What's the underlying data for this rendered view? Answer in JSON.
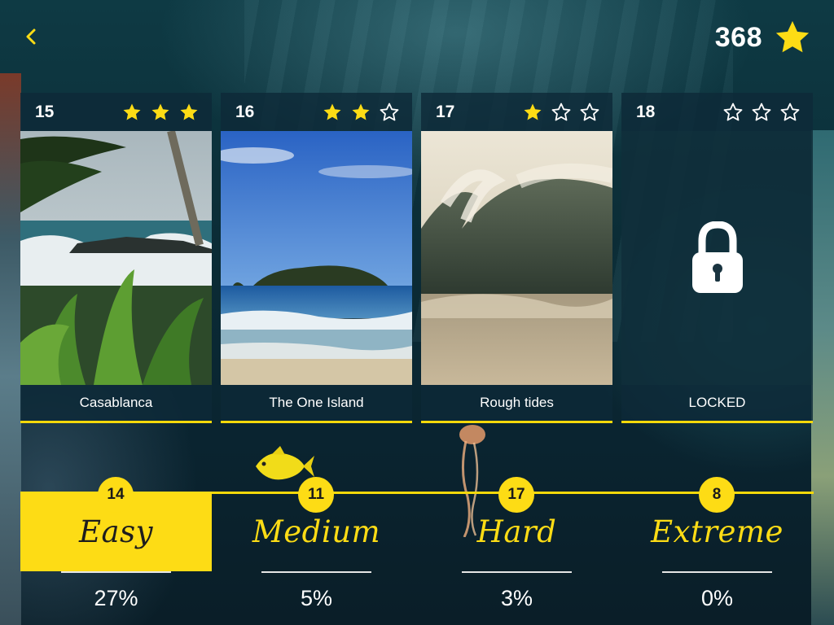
{
  "header": {
    "back_icon": "chevron-left-icon",
    "score": "368",
    "score_icon": "star-icon"
  },
  "colors": {
    "accent": "#fddc15",
    "card_bg": "#0e2a38",
    "star_filled": "#fddc15",
    "star_empty": "#ffffff"
  },
  "levels": [
    {
      "number": "15",
      "stars": 3,
      "title": "Casablanca",
      "image": "tropical-beach-palms",
      "locked": false
    },
    {
      "number": "16",
      "stars": 2,
      "title": "The One Island",
      "image": "island-blue-sky",
      "locked": false
    },
    {
      "number": "17",
      "stars": 1,
      "title": "Rough tides",
      "image": "breaking-wave",
      "locked": false
    },
    {
      "number": "18",
      "stars": 0,
      "title": "LOCKED",
      "image": "lock-icon",
      "locked": true
    }
  ],
  "difficulties": [
    {
      "count": "14",
      "name": "Easy",
      "percent": "27%",
      "active": true
    },
    {
      "count": "11",
      "name": "Medium",
      "percent": "5%",
      "active": false
    },
    {
      "count": "17",
      "name": "Hard",
      "percent": "3%",
      "active": false
    },
    {
      "count": "8",
      "name": "Extreme",
      "percent": "0%",
      "active": false
    }
  ]
}
